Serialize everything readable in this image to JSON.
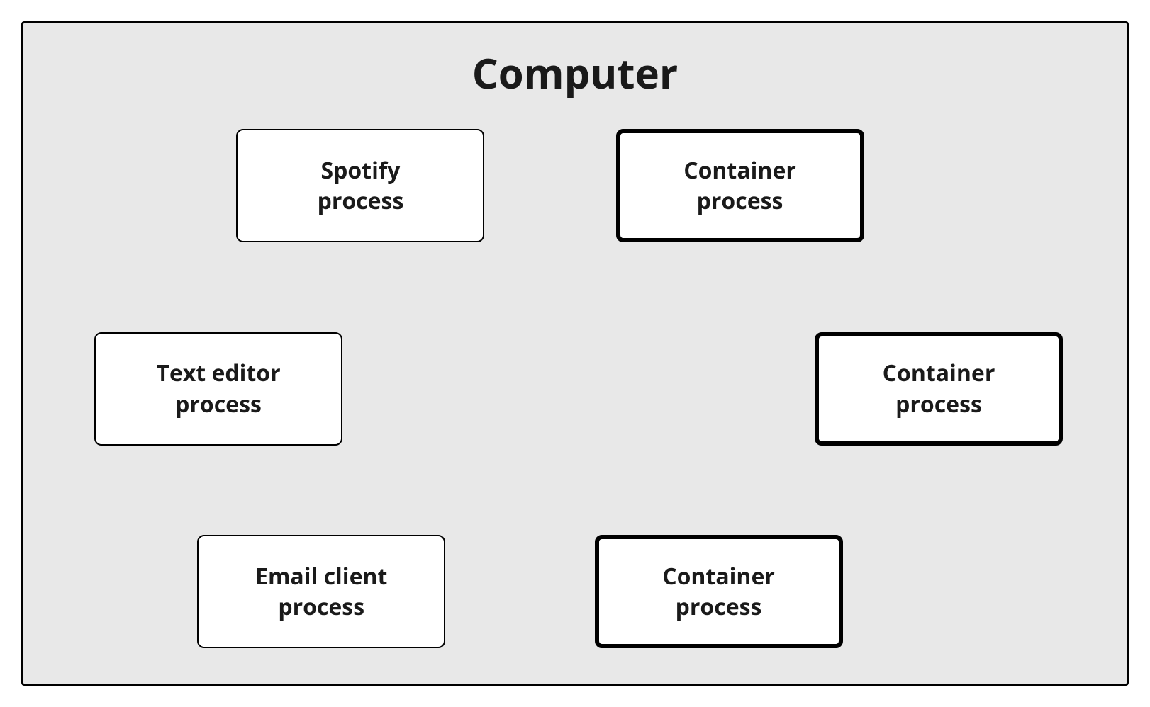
{
  "diagram": {
    "title": "Computer",
    "left_processes": [
      {
        "label": "Spotify\nprocess",
        "emphasis": "thin"
      },
      {
        "label": "Text editor\nprocess",
        "emphasis": "thin"
      },
      {
        "label": "Email client\nprocess",
        "emphasis": "thin"
      }
    ],
    "right_processes": [
      {
        "label": "Container\nprocess",
        "emphasis": "thick"
      },
      {
        "label": "Container\nprocess",
        "emphasis": "thick"
      },
      {
        "label": "Container\nprocess",
        "emphasis": "thick"
      }
    ]
  }
}
